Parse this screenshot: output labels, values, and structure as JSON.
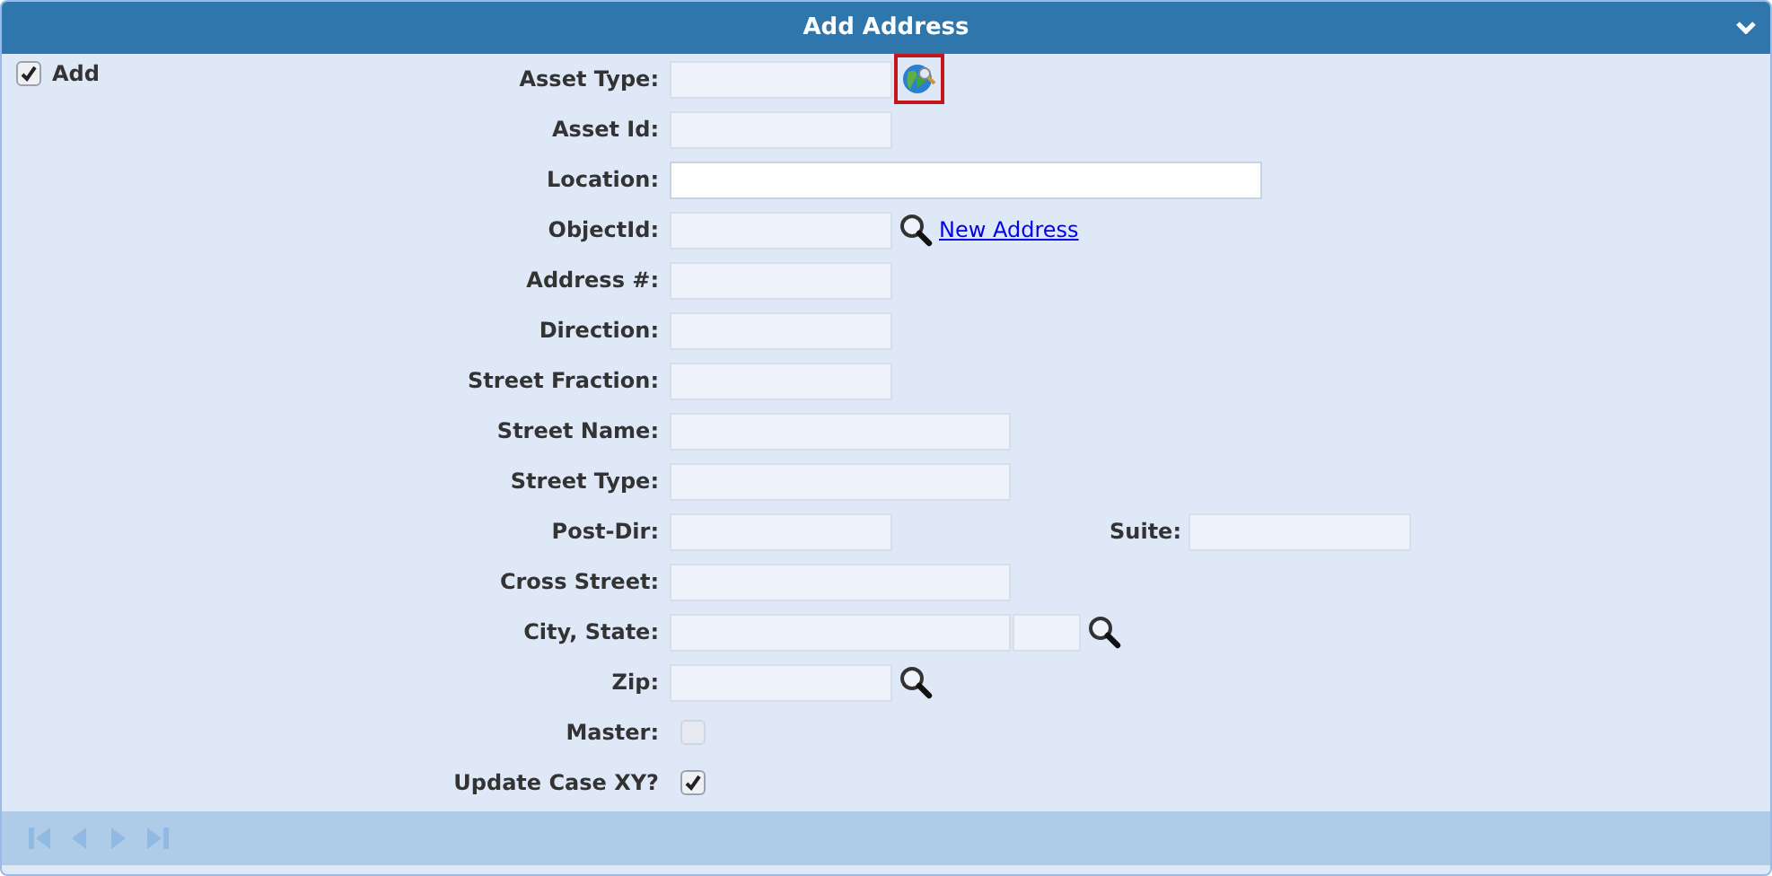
{
  "header": {
    "title": "Add Address",
    "collapsed": false
  },
  "add_toggle": {
    "label": "Add",
    "checked": true
  },
  "rows": [
    {
      "label": "Asset Type:",
      "kind": "field",
      "fields": [
        {
          "kind": "short",
          "disabled": true
        }
      ],
      "action": {
        "kind": "globe",
        "focused": true
      }
    },
    {
      "label": "Asset Id:",
      "kind": "field",
      "fields": [
        {
          "kind": "short",
          "disabled": true
        }
      ]
    },
    {
      "label": "Location:",
      "kind": "field",
      "fields": [
        {
          "kind": "wide",
          "disabled": false
        }
      ]
    },
    {
      "label": "ObjectId:",
      "kind": "field",
      "fields": [
        {
          "kind": "short",
          "disabled": true
        }
      ],
      "action": {
        "kind": "search",
        "focused": false
      },
      "link": "New Address"
    },
    {
      "label": "Address #:",
      "kind": "field",
      "fields": [
        {
          "kind": "short",
          "disabled": true
        }
      ]
    },
    {
      "label": "Direction:",
      "kind": "field",
      "fields": [
        {
          "kind": "short",
          "disabled": true
        }
      ]
    },
    {
      "label": "Street Fraction:",
      "kind": "field",
      "fields": [
        {
          "kind": "short",
          "disabled": true
        }
      ]
    },
    {
      "label": "Street Name:",
      "kind": "field",
      "fields": [
        {
          "kind": "medium",
          "disabled": true
        }
      ]
    },
    {
      "label": "Street Type:",
      "kind": "field",
      "fields": [
        {
          "kind": "medium",
          "disabled": true
        }
      ]
    },
    {
      "label": "Post-Dir:",
      "kind": "field",
      "fields": [
        {
          "kind": "short",
          "disabled": true
        }
      ],
      "side": {
        "label": "Suite:",
        "disabled": true
      }
    },
    {
      "label": "Cross Street:",
      "kind": "field",
      "fields": [
        {
          "kind": "medium",
          "disabled": true
        }
      ]
    },
    {
      "label": "City, State:",
      "kind": "field",
      "fields": [
        {
          "kind": "medium",
          "disabled": true
        },
        {
          "kind": "narrow",
          "disabled": true
        }
      ],
      "action": {
        "kind": "search",
        "focused": false
      }
    },
    {
      "label": "Zip:",
      "kind": "field",
      "fields": [
        {
          "kind": "short",
          "disabled": true
        }
      ],
      "action": {
        "kind": "search",
        "focused": false
      }
    },
    {
      "label": "Master:",
      "kind": "checkbox",
      "checked": false,
      "disabled": true
    },
    {
      "label": "Update Case XY?",
      "kind": "checkbox",
      "checked": true,
      "disabled": false
    }
  ],
  "pager": {
    "disabled": true
  }
}
